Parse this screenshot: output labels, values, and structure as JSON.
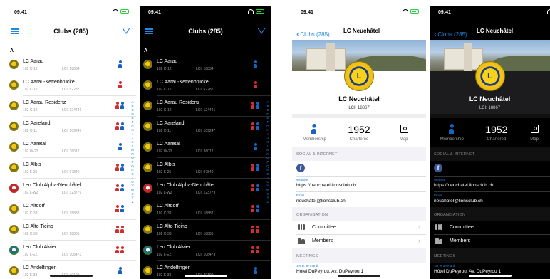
{
  "status": {
    "time": "09:41"
  },
  "list": {
    "title": "Clubs (285)",
    "section": "A",
    "clubs": [
      {
        "name": "LC Aarau",
        "district": "102 C-12",
        "lci": "LCI: 18834",
        "members": "one",
        "icon": "person-icon"
      },
      {
        "name": "LC Aarau-Kettenbrücke",
        "district": "102 C-12",
        "lci": "LCI: 52287",
        "members": "one-red",
        "icon": "person-icon"
      },
      {
        "name": "LC Aarau Residenz",
        "district": "102 C-12",
        "lci": "LCI: 124441",
        "members": "mixed",
        "icon": "person-pair-icon"
      },
      {
        "name": "LC Aareland",
        "district": "102 C-11",
        "lci": "LCI: 109247",
        "members": "mixed",
        "icon": "person-pair-icon"
      },
      {
        "name": "LC Aaretal",
        "district": "102 W-23",
        "lci": "LCI: 36012",
        "members": "one",
        "icon": "person-icon"
      },
      {
        "name": "LC Albis",
        "district": "102 E-25",
        "lci": "LCI: 97840",
        "members": "mixed",
        "icon": "person-pair-icon"
      },
      {
        "name": "Leo Club Alpha-Neuchâtel",
        "district": "102 L-WZ",
        "lci": "LCI: 123779",
        "members": "mixed",
        "icon": "person-pair-icon"
      },
      {
        "name": "LC Altdorf",
        "district": "102 C-32",
        "lci": "LCI: 18882",
        "members": "mixed",
        "icon": "person-pair-icon"
      },
      {
        "name": "LC Alto Ticino",
        "district": "102 C-33",
        "lci": "LCI: 18881",
        "members": "red-pair",
        "icon": "person-pair-icon"
      },
      {
        "name": "Leo Club Alvier",
        "district": "102 L-EZ",
        "lci": "LCI: 108473",
        "members": "red-pair",
        "icon": "person-pair-icon"
      },
      {
        "name": "LC Andelfingen",
        "district": "102 E-33",
        "lci": "LCI: 49199",
        "members": "one",
        "icon": "person-icon"
      }
    ],
    "index": [
      "A",
      "B",
      "C",
      "D",
      "E",
      "F",
      "G",
      "H",
      "I",
      "J",
      "K",
      "L",
      "M",
      "N",
      "O",
      "P",
      "Q",
      "R",
      "S",
      "T",
      "U",
      "V",
      "W",
      "X",
      "Y",
      "Z"
    ]
  },
  "detail": {
    "back_label": "Clubs (285)",
    "title": "LC Neuchâtel",
    "logo_text": "L",
    "club_name": "LC Neuchâtel",
    "club_lci": "LCI: 18867",
    "stats": {
      "membership_label": "Membership",
      "chartered_value": "1952",
      "chartered_label": "Chartered",
      "map_label": "Map"
    },
    "social_header": "SOCIAL & INTERNET",
    "website_label": "Website",
    "website_value": "https://neuchatel.lionsclub.ch",
    "email_label": "Email",
    "email_value": "neuchatel@lionsclub.ch",
    "org_header": "ORGANISATION",
    "committee_label": "Committee",
    "members_label": "Members",
    "meetings_header": "MEETINGS",
    "meeting_days": "1er et 3e mardi",
    "meeting_place": "Hôtel DuPeyrou, Av. DuPeyrou 1"
  },
  "colors": {
    "accent": "#1e88e5",
    "member_blue": "#1565c0",
    "member_red": "#d32f2f"
  }
}
